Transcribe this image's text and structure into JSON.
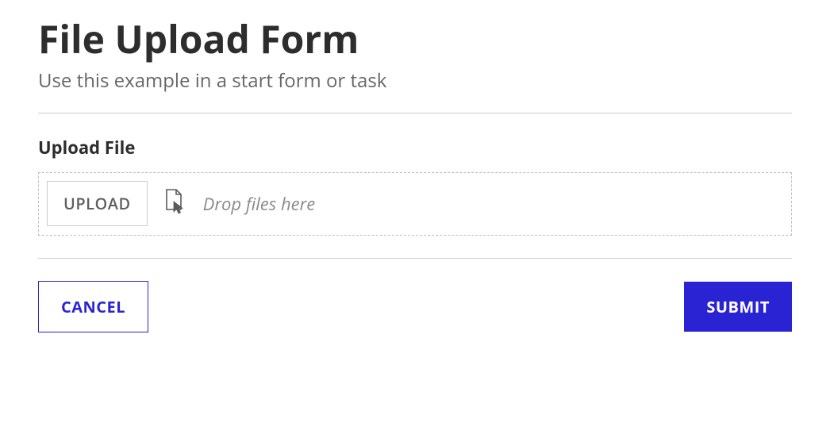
{
  "header": {
    "title": "File Upload Form",
    "subtitle": "Use this example in a start form or task"
  },
  "upload": {
    "section_label": "Upload File",
    "button_label": "UPLOAD",
    "drop_hint": "Drop files here",
    "drop_icon": "file-cursor-icon"
  },
  "footer": {
    "cancel_label": "CANCEL",
    "submit_label": "SUBMIT"
  },
  "colors": {
    "primary": "#2a23d4",
    "text": "#2d2d2d",
    "muted": "#676767",
    "border": "#cccccc"
  }
}
